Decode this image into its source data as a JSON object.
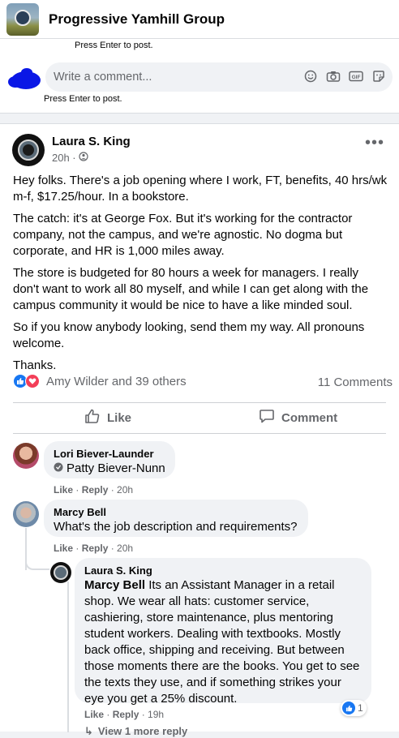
{
  "header": {
    "group_name": "Progressive Yamhill Group"
  },
  "top_card": {
    "press_enter_top": "Press Enter to post.",
    "composer_placeholder": "Write a comment...",
    "press_enter_bottom": "Press Enter to post.",
    "icons": [
      "smile-icon",
      "camera-icon",
      "gif-icon",
      "sticker-icon"
    ]
  },
  "post": {
    "author": "Laura S. King",
    "time": "20h ·",
    "privacy_icon": "group-icon",
    "paragraphs": [
      "Hey folks. There's a job opening where I work, FT, benefits, 40 hrs/wk m-f, $17.25/hour. In a bookstore.",
      "The catch: it's at George Fox. But it's working for the contractor company, not the campus, and we're agnostic. No dogma but corporate, and HR is 1,000 miles away.",
      "The store is budgeted for 80 hours a week for managers. I really don't want to work all 80 myself, and while I can get along with the campus community it would be nice to have a like minded soul.",
      "So if you know anybody looking, send them my way. All pronouns welcome.",
      "Thanks."
    ],
    "reactions_names": "Amy Wilder and 39 others",
    "comments_count": "11 Comments",
    "like_label": "Like",
    "comment_label": "Comment",
    "colors": {
      "like_blue": "#1877f2",
      "love_red": "#f33e58"
    }
  },
  "comments": [
    {
      "name": "Lori Biever-Launder",
      "tag": "Patty Biever-Nunn",
      "like": "Like",
      "reply": "Reply",
      "time": "20h"
    },
    {
      "name": "Marcy Bell",
      "text": "What's the job description and requirements?",
      "like": "Like",
      "reply": "Reply",
      "time": "20h"
    }
  ],
  "reply": {
    "name": "Laura S. King",
    "mention": "Marcy Bell",
    "text": " Its an Assistant Manager in a retail shop. We wear all hats: customer service, cashiering, store maintenance, plus mentoring student workers. Dealing with textbooks. Mostly back office, shipping and receiving. But between those moments there are the books. You get to see the texts they use, and if something strikes your eye you get a 25% discount.",
    "reaction_count": "1",
    "like": "Like",
    "reply_label": "Reply",
    "time": "19h",
    "view_more": "View 1 more reply"
  }
}
